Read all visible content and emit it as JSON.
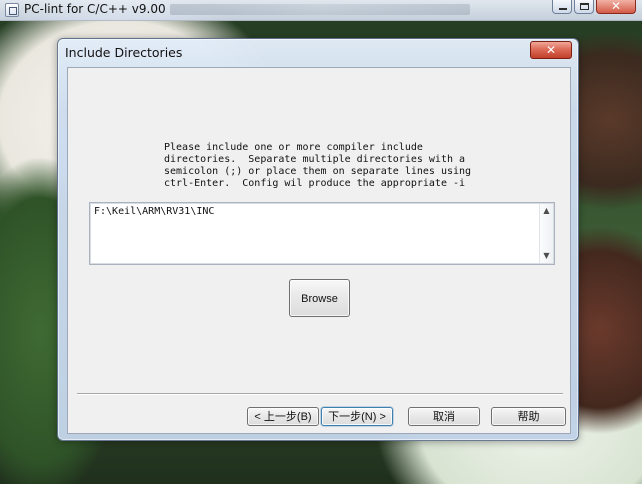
{
  "background_window": {
    "title": "PC-lint for C/C++ v9.00",
    "controls": [
      "minimize",
      "maximize",
      "close"
    ]
  },
  "dialog": {
    "title": "Include Directories",
    "close_icon": "close-icon",
    "instructions": "Please include one or more compiler include\ndirectories.  Separate multiple directories with a\nsemicolon (;) or place them on separate lines using\nctrl-Enter.  Config wil produce the appropriate -i",
    "include_value": "F:\\Keil\\ARM\\RV31\\INC",
    "buttons": {
      "browse": "Browse",
      "back": "< 上一步(B)",
      "next": "下一步(N) >",
      "cancel": "取消",
      "help": "帮助"
    }
  }
}
